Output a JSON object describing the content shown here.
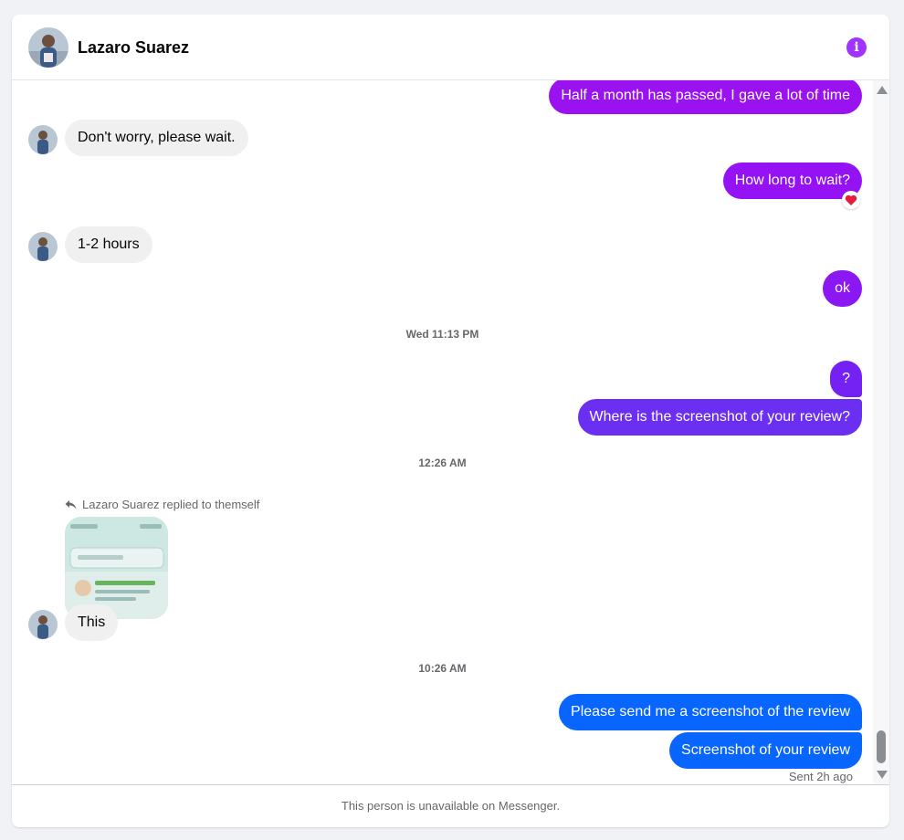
{
  "header": {
    "name": "Lazaro Suarez",
    "info_icon": "info-icon"
  },
  "colors": {
    "accent_purple": "#a033ff",
    "bubble_violet": "#8c16f5",
    "bubble_indigo": "#6b2ff2",
    "bubble_blue": "#0866ff",
    "incoming_bg": "#f0f0f0"
  },
  "messages": [
    {
      "text": "Half a month has passed, I gave a lot of time",
      "side": "out"
    },
    {
      "text": "Don't worry, please wait.",
      "side": "in"
    },
    {
      "text": "How long to wait?",
      "side": "out",
      "reaction": "heart-reaction-icon"
    },
    {
      "text": "1-2 hours",
      "side": "in"
    },
    {
      "text": "ok",
      "side": "out"
    },
    {
      "text": "?",
      "side": "out"
    },
    {
      "text": "Where is the screenshot of your review?",
      "side": "out"
    },
    {
      "text": "This",
      "side": "in"
    },
    {
      "text": "Please send me a screenshot of the review",
      "side": "out"
    },
    {
      "text": "Screenshot of your review",
      "side": "out"
    }
  ],
  "timestamps": [
    "Wed 11:13 PM",
    "12:26 AM",
    "10:26 AM"
  ],
  "reply_note": "Lazaro Suarez replied to themself",
  "status": "Sent 2h ago",
  "footer": "This person is unavailable on Messenger."
}
